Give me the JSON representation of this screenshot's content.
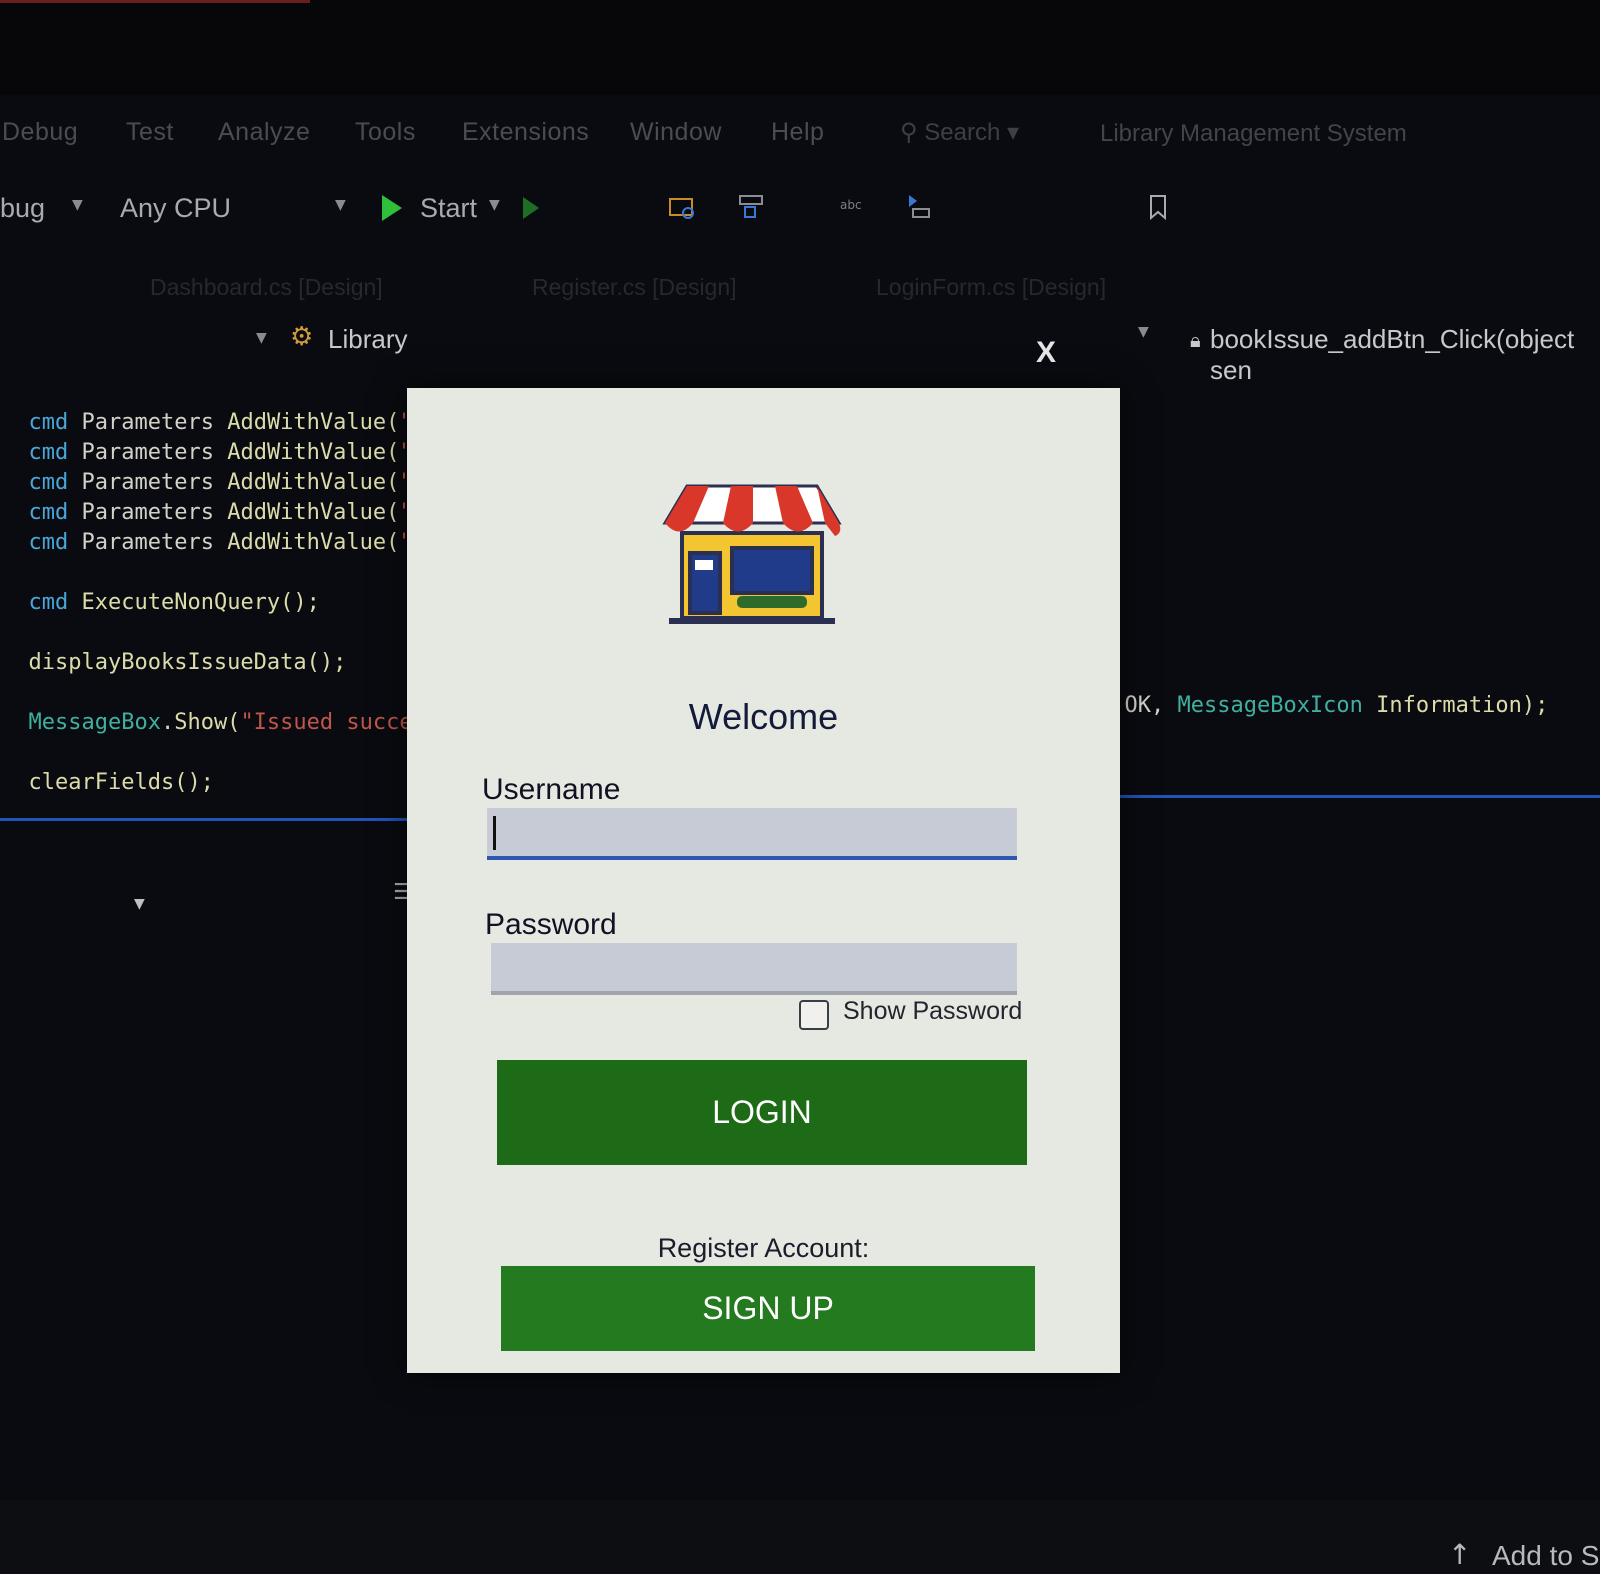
{
  "menu": {
    "items": [
      "Debug",
      "Test",
      "Analyze",
      "Tools",
      "Extensions",
      "Window",
      "Help"
    ],
    "search": "Search",
    "window_title": "Library Management System"
  },
  "toolbar": {
    "config": "bug",
    "platform": "Any CPU",
    "start_label": "Start"
  },
  "tabs": [
    "Dashboard.cs [Design]",
    "Register.cs [Design]",
    "LoginForm.cs [Design]"
  ],
  "nav": {
    "project": "Library",
    "method": "bookIssue_addBtn_Click(object sen"
  },
  "code": {
    "cmd": "cmd",
    "parameters": "Parameters",
    "add_with_value": "AddWithValue(",
    "quote": "\"",
    "execute": "ExecuteNonQuery();",
    "display": "displayBooksIssueData();",
    "messagebox": "MessageBox",
    "show": "Show(",
    "issued": "\"Issued succes",
    "right_tail_ok": "OK, ",
    "right_tail_icon": "MessageBoxIcon",
    "right_tail_info": " Information);",
    "clear": "clearFields();"
  },
  "dialog": {
    "close": "X",
    "welcome": "Welcome",
    "username_label": "Username",
    "username_value": "",
    "password_label": "Password",
    "password_value": "",
    "show_password": "Show Password",
    "login_button": "LOGIN",
    "register_label": "Register Account:",
    "signup_button": "SIGN UP"
  },
  "status": {
    "add_to": "Add to S"
  },
  "colors": {
    "accent_green": "#1d6a17",
    "focus_blue": "#2d57b0",
    "play_green": "#2fbf3a"
  }
}
